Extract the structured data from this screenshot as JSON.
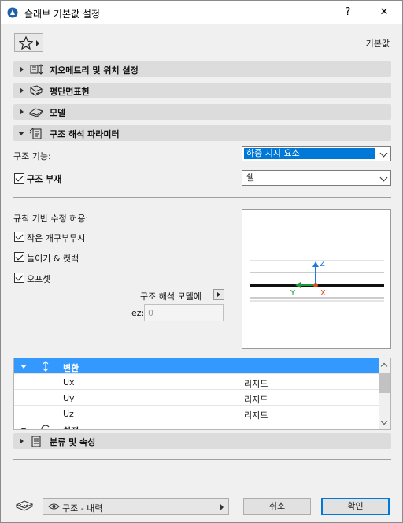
{
  "window": {
    "title": "슬래브 기본값 설정",
    "help_label": "?",
    "close_label": "✕"
  },
  "toolbar": {
    "favorites_icon": "star-icon",
    "defaults_label": "기본값"
  },
  "sections": {
    "geometry": "지오메트리 및 위치 설정",
    "floorplan": "평단면표현",
    "model": "모델",
    "structural": "구조 해석 파라미터",
    "classification": "분류 및 속성"
  },
  "structural": {
    "function_label": "구조 기능:",
    "function_value": "하중 지지 요소",
    "member_label": "구조 부재",
    "member_value": "쉘",
    "rules_label": "규칙 기반 수정 허용:",
    "option1": "작은 개구부무시",
    "option2": "늘이기 & 컷백",
    "option3": "오프셋",
    "model_label": "구조 해석 모델에",
    "ez_label": "ez:",
    "ez_value": "0"
  },
  "preview": {
    "axis_z": "Z",
    "axis_y": "Y",
    "axis_x": "X",
    "colors": {
      "z": "#1e7be0",
      "y": "#1f9a3a",
      "x": "#e04a1a"
    }
  },
  "table": {
    "header_label": "변환",
    "rows": [
      {
        "name": "Ux",
        "value": "리지드"
      },
      {
        "name": "Uy",
        "value": "리지드"
      },
      {
        "name": "Uz",
        "value": "리지드"
      }
    ],
    "partial_row_label": "회전"
  },
  "footer": {
    "view_label": "구조 - 내력",
    "cancel_label": "취소",
    "ok_label": "확인"
  },
  "colors": {
    "accent": "#0078d7",
    "selection_row": "#3399ff"
  }
}
